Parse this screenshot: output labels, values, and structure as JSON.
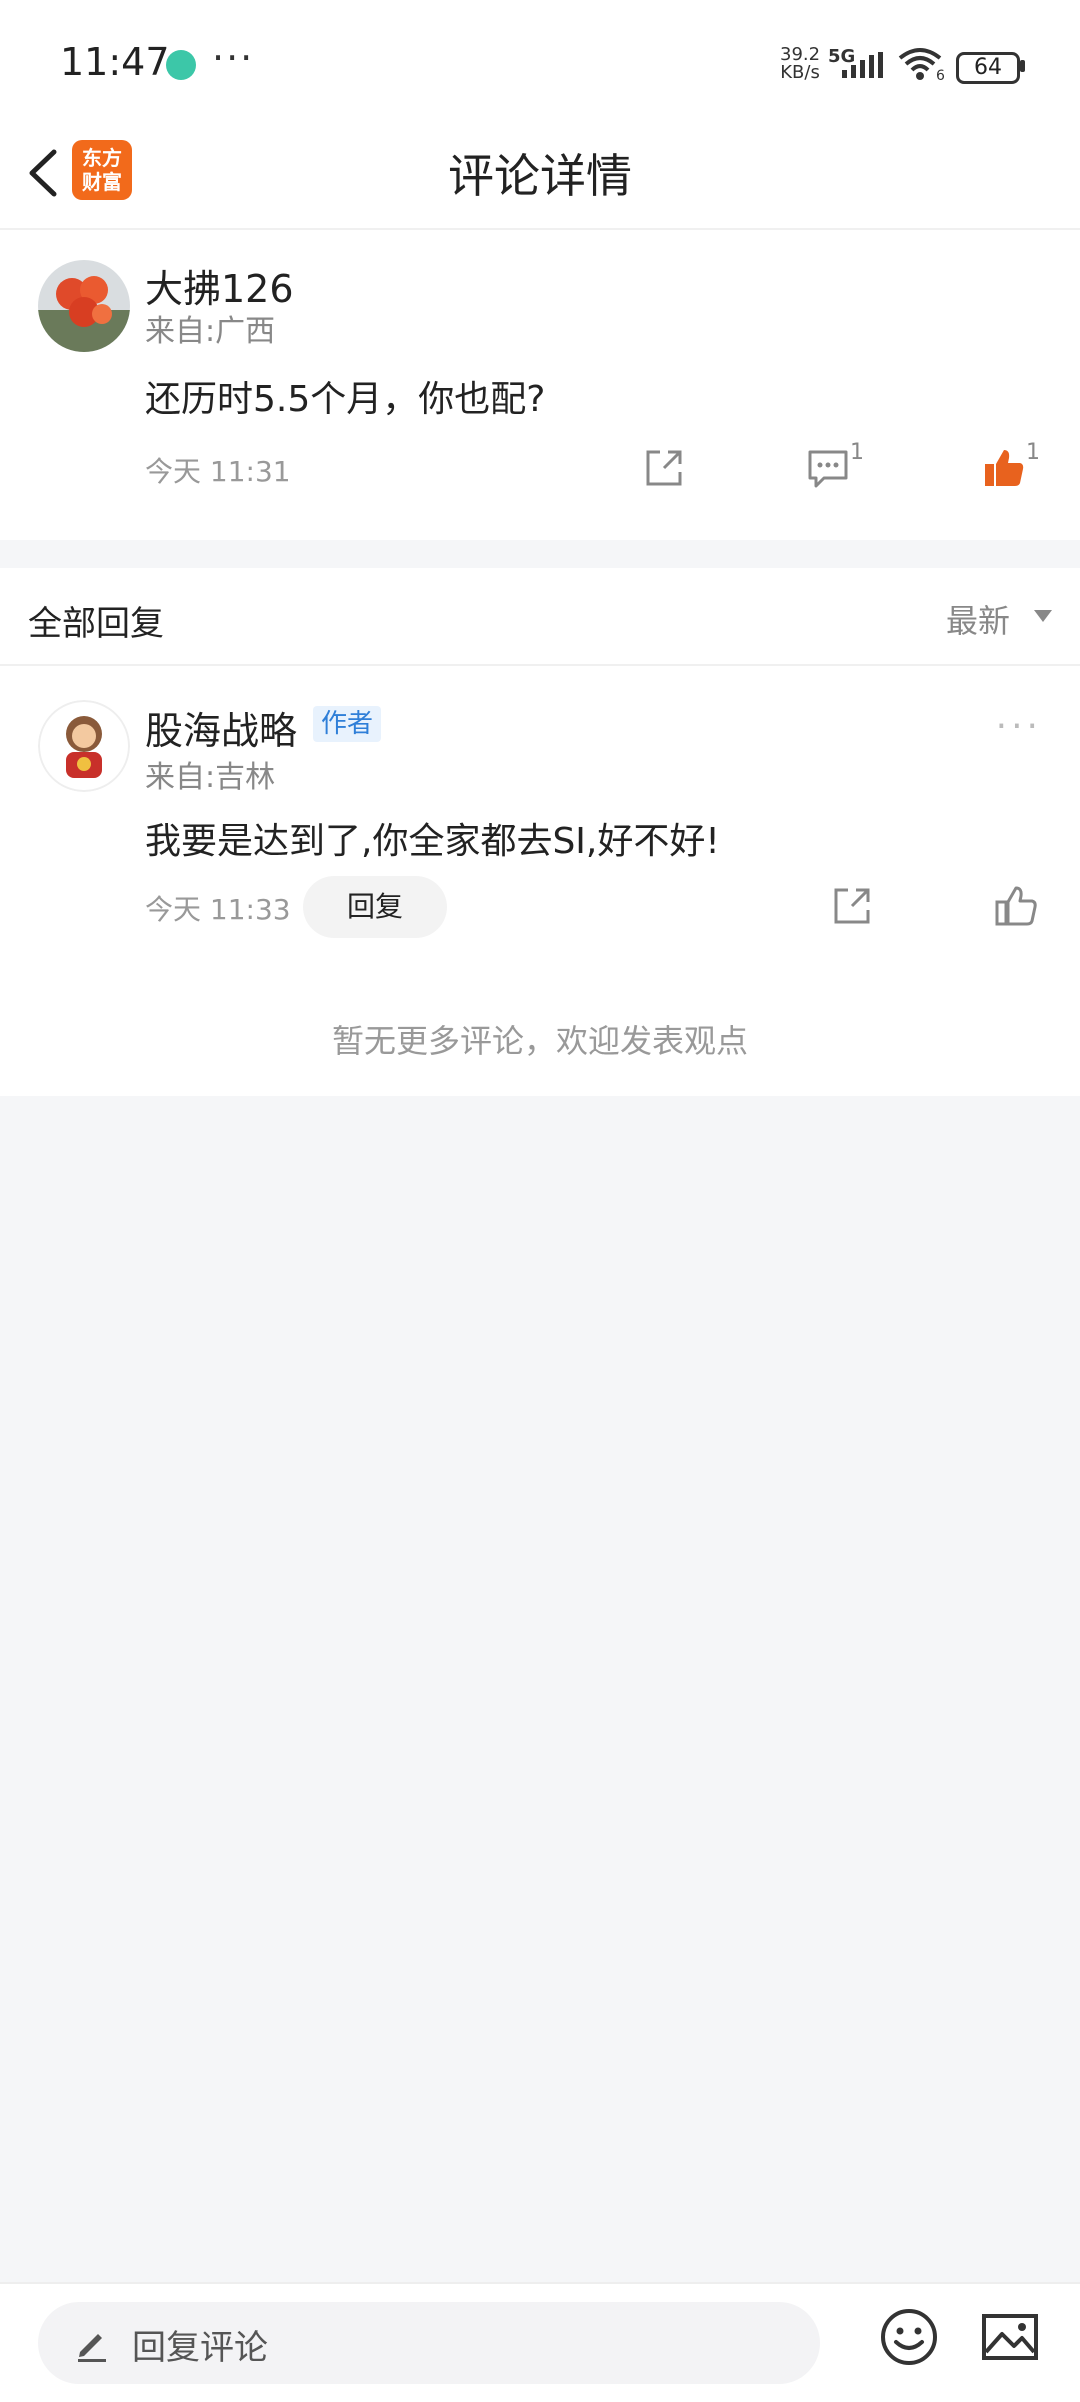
{
  "status_bar": {
    "time": "11:47",
    "more": "···",
    "speed_value": "39.2",
    "speed_unit": "KB/s",
    "network": "5G",
    "wifi_badge": "6",
    "battery": "64"
  },
  "header": {
    "title": "评论详情",
    "logo_line1": "东方",
    "logo_line2": "财富"
  },
  "main_comment": {
    "username": "大拂126",
    "location": "来自:广西",
    "text": "还历时5.5个月，你也配?",
    "time": "今天 11:31",
    "comment_count": "1",
    "like_count": "1"
  },
  "replies_header": {
    "title": "全部回复",
    "sort": "最新"
  },
  "reply": {
    "username": "股海战略",
    "badge": "作者",
    "location": "来自:吉林",
    "text": "我要是达到了,你全家都去SI,好不好!",
    "time": "今天 11:33",
    "reply_label": "回复"
  },
  "footer_note": "暂无更多评论，欢迎发表观点",
  "bottom_bar": {
    "placeholder": "回复评论"
  },
  "colors": {
    "accent": "#f26a1b",
    "like_active": "#e8621e",
    "author_tag": "#2f7fd8",
    "background": "#f5f6f8"
  },
  "icons": [
    "back-arrow-icon",
    "share-icon",
    "comment-icon",
    "thumb-up-icon",
    "more-dots-icon",
    "pencil-icon",
    "emoji-icon",
    "image-icon"
  ]
}
